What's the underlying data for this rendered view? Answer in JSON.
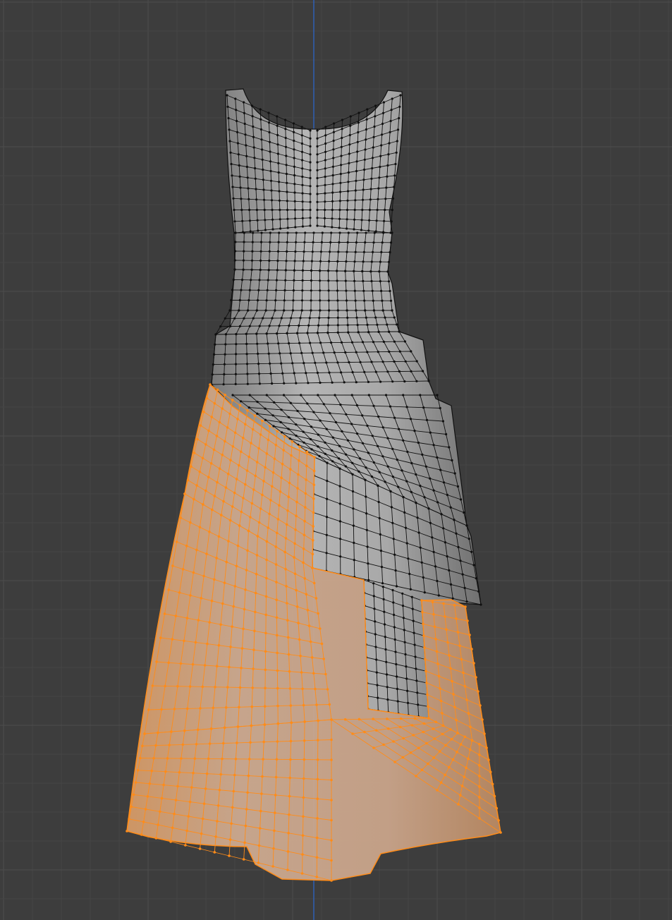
{
  "viewport": {
    "background_color": "#3d3d3d",
    "grid_minor_color": "#454545",
    "grid_major_color": "#4d4d4d",
    "axis_color": "#2f5fb3",
    "axis": "z"
  },
  "mesh": {
    "object": "dress",
    "shading": "solid",
    "mode": "edit",
    "overlay": "wireframe",
    "selection": "skirt panel",
    "surface_color": "#a6a6a6",
    "unselected_wire_color": "#101010",
    "selected_wire_color": "#ff8c19",
    "selected_fill_color": "#c8a38a"
  }
}
